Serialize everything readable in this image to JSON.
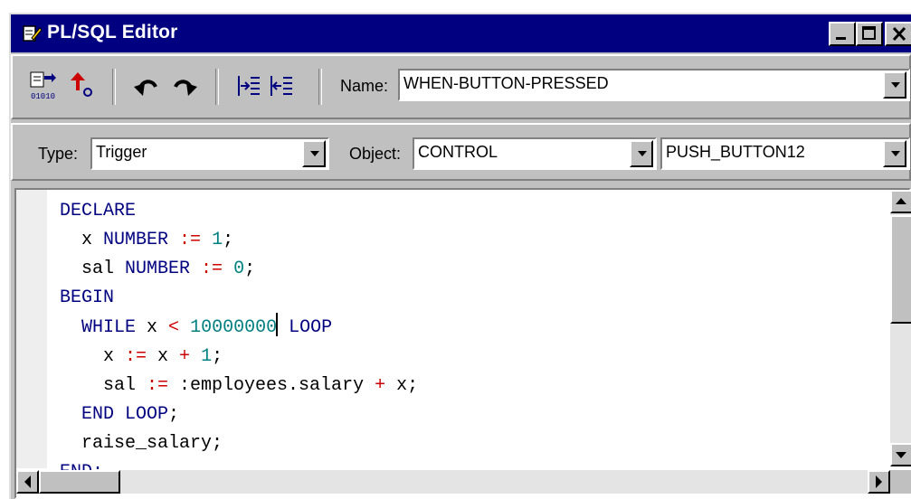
{
  "window": {
    "title": "PL/SQL Editor"
  },
  "toolbar": {
    "compile_icon": "compile-icon",
    "revert_icon": "revert-icon",
    "undo_icon": "undo-icon",
    "redo_icon": "redo-icon",
    "indent_icon": "indent-icon",
    "outdent_icon": "outdent-icon",
    "name_label": "Name:",
    "name_value": "WHEN-BUTTON-PRESSED"
  },
  "context": {
    "type_label": "Type:",
    "type_value": "Trigger",
    "object_label": "Object:",
    "object_value": "CONTROL",
    "item_value": "PUSH_BUTTON12"
  },
  "code": {
    "lines": [
      "DECLARE",
      "  x NUMBER := 1;",
      "  sal NUMBER := 0;",
      "BEGIN",
      "  WHILE x < 10000000 LOOP",
      "    x := x + 1;",
      "    sal := :employees.salary + x;",
      "  END LOOP;",
      "  raise_salary;",
      "END;"
    ]
  },
  "colors": {
    "titlebar": "#000080",
    "keyword": "#000080",
    "operator": "#cc0000",
    "number": "#008080",
    "chrome": "#c0c0c0"
  }
}
